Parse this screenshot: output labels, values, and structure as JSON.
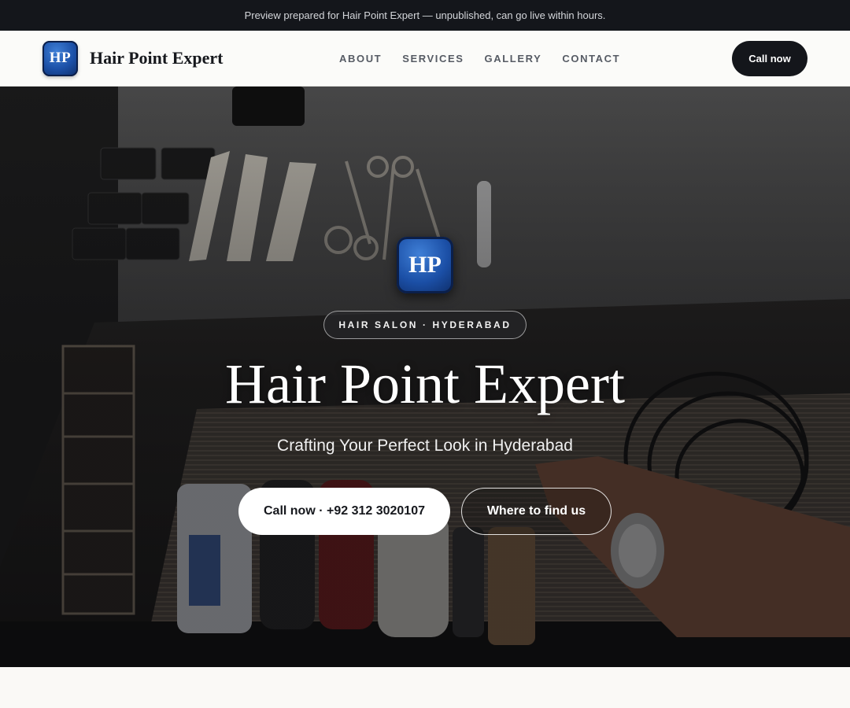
{
  "announcement": "Preview prepared for Hair Point Expert — unpublished, can go live within hours.",
  "header": {
    "logo_initials": "HP",
    "brand_name": "Hair Point Expert",
    "nav": [
      "ABOUT",
      "SERVICES",
      "GALLERY",
      "CONTACT"
    ],
    "cta_label": "Call now"
  },
  "hero": {
    "badge_initials": "HP",
    "tagline": "HAIR SALON · HYDERABAD",
    "title": "Hair Point Expert",
    "subtitle": "Crafting Your Perfect Look in Hyderabad",
    "primary_button": "Call now · +92 312 3020107",
    "secondary_button": "Where to find us",
    "background_description_icon": "barber-tools-photo"
  },
  "colors": {
    "accent_dark": "#14161b",
    "logo_blue": "#1b4fa6",
    "page_background": "#faf9f6"
  }
}
